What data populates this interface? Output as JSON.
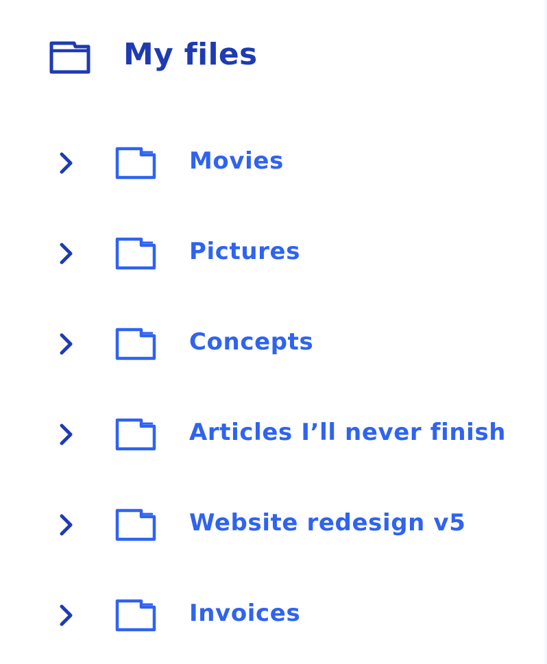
{
  "header": {
    "title": "My files",
    "icon": "folder-icon"
  },
  "tree": {
    "items": [
      {
        "label": "Movies",
        "icon": "folder-icon",
        "expand_icon": "chevron-right-icon"
      },
      {
        "label": "Pictures",
        "icon": "folder-icon",
        "expand_icon": "chevron-right-icon"
      },
      {
        "label": "Concepts",
        "icon": "folder-icon",
        "expand_icon": "chevron-right-icon"
      },
      {
        "label": "Articles I’ll never finish",
        "icon": "folder-icon",
        "expand_icon": "chevron-right-icon"
      },
      {
        "label": "Website redesign v5",
        "icon": "folder-icon",
        "expand_icon": "chevron-right-icon"
      },
      {
        "label": "Invoices",
        "icon": "folder-icon",
        "expand_icon": "chevron-right-icon"
      }
    ]
  },
  "colors": {
    "header_title": "#1e3bb3",
    "header_icon": "#1e3bb3",
    "item_label": "#2f63f0",
    "item_icon": "#2f63f0",
    "chevron": "#1e3bb3",
    "background": "#ffffff"
  }
}
